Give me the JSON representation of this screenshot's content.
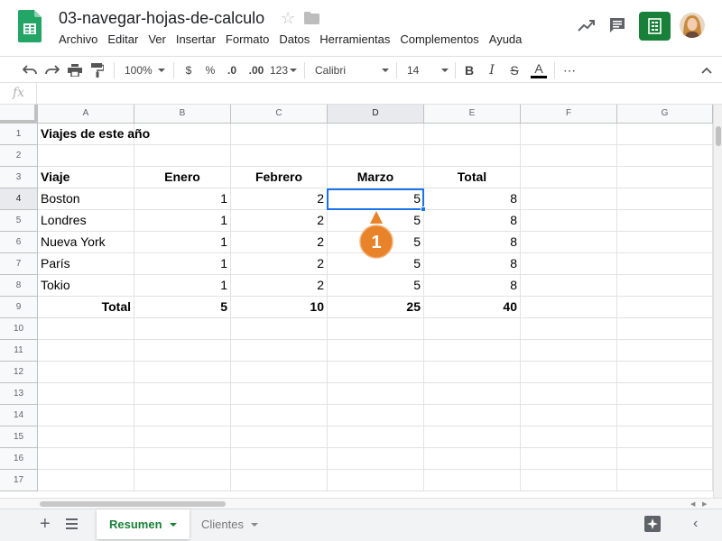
{
  "doc": {
    "title": "03-navegar-hojas-de-calculo"
  },
  "menu": [
    "Archivo",
    "Editar",
    "Ver",
    "Insertar",
    "Formato",
    "Datos",
    "Herramientas",
    "Complementos",
    "Ayuda"
  ],
  "toolbar": {
    "zoom": "100%",
    "currency": "$",
    "percent": "%",
    "decrease_decimals": ".0",
    "increase_decimals": ".00",
    "more_formats": "123",
    "font": "Calibri",
    "font_size": "14",
    "bold": "B",
    "italic": "I",
    "strike": "S",
    "text_color": "A",
    "more": "⋯"
  },
  "formula_bar": {
    "icon": "fx",
    "value": ""
  },
  "columns": [
    "A",
    "B",
    "C",
    "D",
    "E",
    "F",
    "G"
  ],
  "active_column": "D",
  "rows": [
    "1",
    "2",
    "3",
    "4",
    "5",
    "6",
    "7",
    "8",
    "9",
    "10",
    "11",
    "12",
    "13",
    "14",
    "15",
    "16",
    "17"
  ],
  "active_row": "4",
  "cells": {
    "r1": {
      "A": "Viajes de este año"
    },
    "r3": {
      "A": "Viaje",
      "B": "Enero",
      "C": "Febrero",
      "D": "Marzo",
      "E": "Total"
    },
    "r4": {
      "A": "Boston",
      "B": "1",
      "C": "2",
      "D": "5",
      "E": "8"
    },
    "r5": {
      "A": "Londres",
      "B": "1",
      "C": "2",
      "D": "5",
      "E": "8"
    },
    "r6": {
      "A": "Nueva York",
      "B": "1",
      "C": "2",
      "D": "5",
      "E": "8"
    },
    "r7": {
      "A": "París",
      "B": "1",
      "C": "2",
      "D": "5",
      "E": "8"
    },
    "r8": {
      "A": "Tokio",
      "B": "1",
      "C": "2",
      "D": "5",
      "E": "8"
    },
    "r9": {
      "A": "Total",
      "B": "5",
      "C": "10",
      "D": "25",
      "E": "40"
    }
  },
  "selected_cell": "D4",
  "callout": {
    "number": "1"
  },
  "sheets": [
    {
      "label": "Resumen",
      "active": true
    },
    {
      "label": "Clientes",
      "active": false
    }
  ],
  "colors": {
    "accent_green": "#188038",
    "selection_blue": "#1a73e8",
    "callout_orange": "#e8832a"
  }
}
